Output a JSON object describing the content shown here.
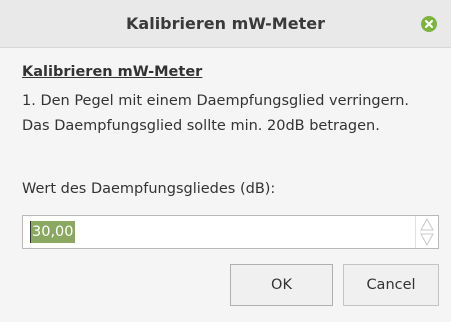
{
  "window": {
    "title": "Kalibrieren mW-Meter"
  },
  "content": {
    "heading": "Kalibrieren mW-Meter",
    "line1": "1. Den Pegel mit einem Daempfungsglied verringern.",
    "line2": "Das Daempfungsglied sollte min. 20dB betragen.",
    "field_label": "Wert des Daempfungsgliedes (dB):",
    "field_value": "30,00"
  },
  "buttons": {
    "ok": "OK",
    "cancel": "Cancel"
  },
  "icons": {
    "close": "close-icon",
    "spin_up": "triangle-up-icon",
    "spin_down": "triangle-down-icon"
  },
  "colors": {
    "close_button": "#7cb342",
    "selection": "#8aa861"
  }
}
